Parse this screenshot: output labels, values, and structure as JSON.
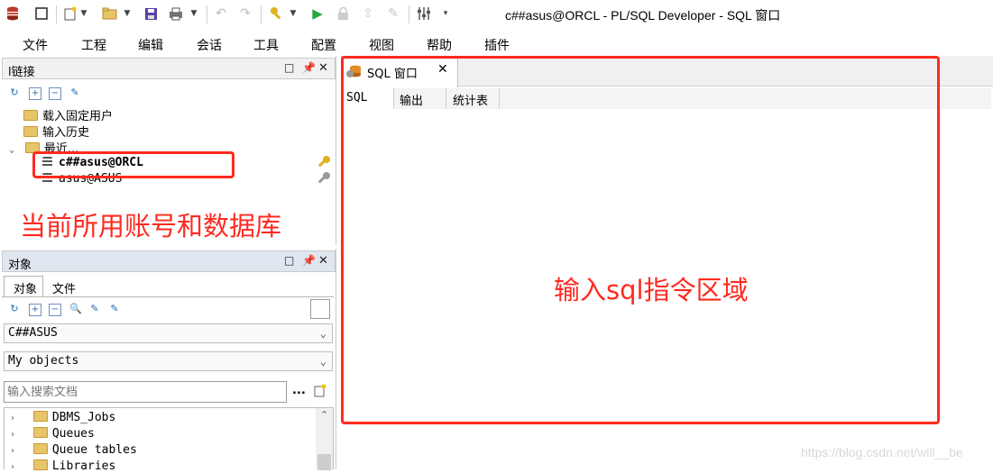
{
  "window": {
    "title": "c##asus@ORCL - PL/SQL Developer - SQL 窗口"
  },
  "toolbar": {
    "icons": [
      "database-icon",
      "window-icon",
      "new-icon",
      "dropdown-arrow",
      "open-folder-icon",
      "dropdown-arrow",
      "save-icon",
      "print-icon",
      "dropdown-arrow",
      "undo-icon",
      "redo-icon",
      "key-icon",
      "dropdown-arrow",
      "run-icon",
      "lock-icon",
      "commit-icon",
      "rollback-icon",
      "settings-sliders-icon",
      "dropdown-arrow"
    ]
  },
  "menubar": {
    "items": [
      "文件",
      "工程",
      "编辑",
      "会话",
      "工具",
      "配置",
      "视图",
      "帮助",
      "插件"
    ]
  },
  "connections_panel": {
    "title": "l链接",
    "tree": [
      {
        "label": "载入固定用户"
      },
      {
        "label": "输入历史"
      },
      {
        "label": "最近..."
      },
      {
        "label": "c##asus@ORCL"
      },
      {
        "label": "asus@ASUS"
      }
    ],
    "annotation": "当前所用账号和数据库"
  },
  "objects_panel": {
    "title": "对象",
    "tabs": [
      "对象",
      "文件"
    ],
    "user_select": "C##ASUS",
    "filter_select": "My objects",
    "search_placeholder": "输入搜索文档",
    "more_label": "...",
    "tree": [
      {
        "label": "DBMS_Jobs"
      },
      {
        "label": "Queues"
      },
      {
        "label": "Queue tables"
      },
      {
        "label": "Libraries"
      }
    ]
  },
  "editor": {
    "tab_label": "SQL 窗口",
    "subtabs": [
      "SQL",
      "输出",
      "统计表"
    ],
    "annotation": "输入sql指令区域"
  },
  "watermark": "https://blog.csdn.net/will__be",
  "colors": {
    "annotation_red": "#ff2a1f",
    "panel_header": "#f1f1f1",
    "selected_tab_bg": "#ffffff"
  }
}
